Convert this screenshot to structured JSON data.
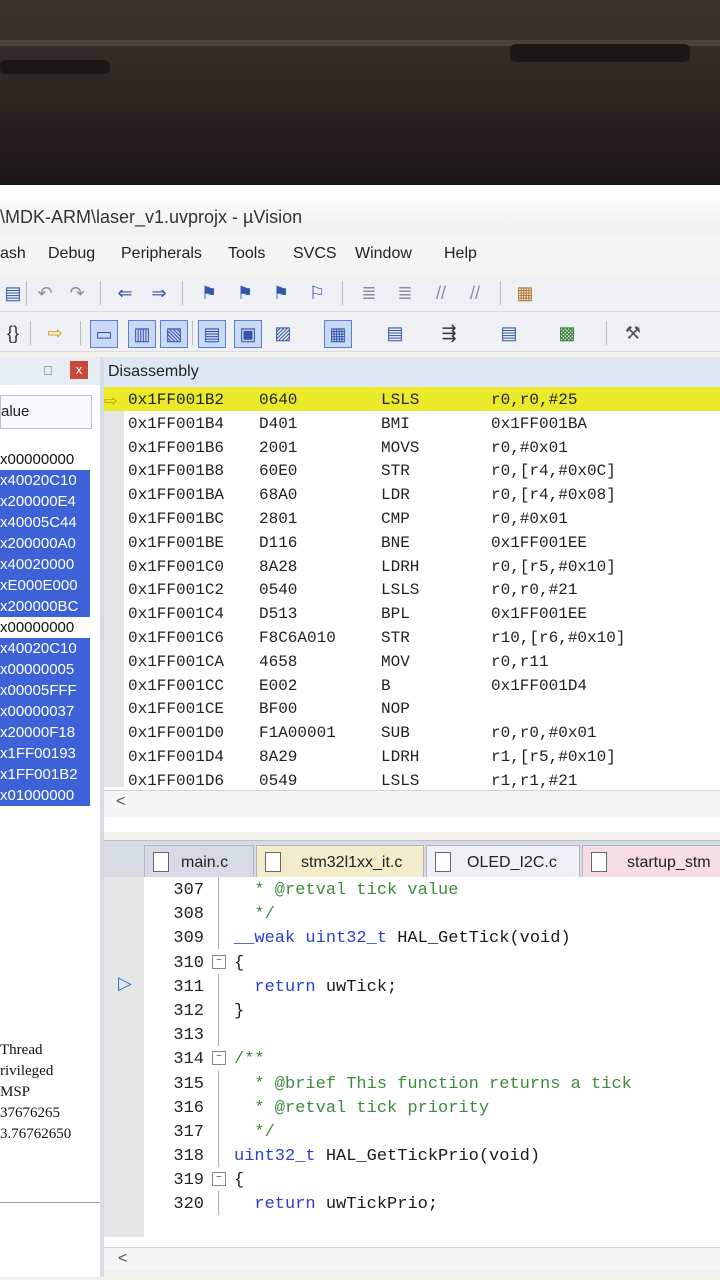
{
  "window": {
    "title": "\\MDK-ARM\\laser_v1.uvprojx - µVision"
  },
  "menu": [
    "ash",
    "Debug",
    "Peripherals",
    "Tools",
    "SVCS",
    "Window",
    "Help"
  ],
  "registers_panel": {
    "pin_label": "⎕",
    "close_label": "x",
    "column_header": "alue",
    "values": [
      {
        "v": "x00000000",
        "hl": false
      },
      {
        "v": "x40020C10",
        "hl": true
      },
      {
        "v": "x200000E4",
        "hl": true
      },
      {
        "v": "x40005C44",
        "hl": true
      },
      {
        "v": "x200000A0",
        "hl": true
      },
      {
        "v": "x40020000",
        "hl": true
      },
      {
        "v": "xE000E000",
        "hl": true
      },
      {
        "v": "x200000BC",
        "hl": true
      },
      {
        "v": "x00000000",
        "hl": false
      },
      {
        "v": "x40020C10",
        "hl": true
      },
      {
        "v": "x00000005",
        "hl": true
      },
      {
        "v": "x00005FFF",
        "hl": true
      },
      {
        "v": "x00000037",
        "hl": true
      },
      {
        "v": "x20000F18",
        "hl": true
      },
      {
        "v": "x1FF00193",
        "hl": true
      },
      {
        "v": "x1FF001B2",
        "hl": true
      },
      {
        "v": "x01000000",
        "hl": true
      }
    ],
    "status": [
      "Thread",
      "rivileged",
      "MSP",
      "37676265",
      "3.76762650"
    ]
  },
  "disassembly": {
    "title": "Disassembly",
    "rows": [
      {
        "addr": "0x1FF001B2",
        "op": "0640",
        "mn": "LSLS",
        "arg": "r0,r0,#25",
        "cur": true
      },
      {
        "addr": "0x1FF001B4",
        "op": "D401",
        "mn": "BMI",
        "arg": "0x1FF001BA",
        "cur": false
      },
      {
        "addr": "0x1FF001B6",
        "op": "2001",
        "mn": "MOVS",
        "arg": "r0,#0x01",
        "cur": false
      },
      {
        "addr": "0x1FF001B8",
        "op": "60E0",
        "mn": "STR",
        "arg": "r0,[r4,#0x0C]",
        "cur": false
      },
      {
        "addr": "0x1FF001BA",
        "op": "68A0",
        "mn": "LDR",
        "arg": "r0,[r4,#0x08]",
        "cur": false
      },
      {
        "addr": "0x1FF001BC",
        "op": "2801",
        "mn": "CMP",
        "arg": "r0,#0x01",
        "cur": false
      },
      {
        "addr": "0x1FF001BE",
        "op": "D116",
        "mn": "BNE",
        "arg": "0x1FF001EE",
        "cur": false
      },
      {
        "addr": "0x1FF001C0",
        "op": "8A28",
        "mn": "LDRH",
        "arg": "r0,[r5,#0x10]",
        "cur": false
      },
      {
        "addr": "0x1FF001C2",
        "op": "0540",
        "mn": "LSLS",
        "arg": "r0,r0,#21",
        "cur": false
      },
      {
        "addr": "0x1FF001C4",
        "op": "D513",
        "mn": "BPL",
        "arg": "0x1FF001EE",
        "cur": false
      },
      {
        "addr": "0x1FF001C6",
        "op": "F8C6A010",
        "mn": "STR",
        "arg": "r10,[r6,#0x10]",
        "cur": false
      },
      {
        "addr": "0x1FF001CA",
        "op": "4658",
        "mn": "MOV",
        "arg": "r0,r11",
        "cur": false
      },
      {
        "addr": "0x1FF001CC",
        "op": "E002",
        "mn": "B",
        "arg": "0x1FF001D4",
        "cur": false
      },
      {
        "addr": "0x1FF001CE",
        "op": "BF00",
        "mn": "NOP",
        "arg": "",
        "cur": false
      },
      {
        "addr": "0x1FF001D0",
        "op": "F1A00001",
        "mn": "SUB",
        "arg": "r0,r0,#0x01",
        "cur": false
      },
      {
        "addr": "0x1FF001D4",
        "op": "8A29",
        "mn": "LDRH",
        "arg": "r1,[r5,#0x10]",
        "cur": false
      },
      {
        "addr": "0x1FF001D6",
        "op": "0549",
        "mn": "LSLS",
        "arg": "r1,r1,#21",
        "cur": false
      }
    ],
    "scroll_left": "<"
  },
  "tabs": [
    {
      "label": "main.c",
      "color": "#d6dbe6"
    },
    {
      "label": "stm32l1xx_it.c",
      "color": "#f3eccb"
    },
    {
      "label": "OLED_I2C.c",
      "color": "#eef0f5"
    },
    {
      "label": "startup_stm",
      "color": "#f5dde3"
    }
  ],
  "editor": {
    "lines": [
      {
        "n": "307",
        "fold": "",
        "parts": [
          [
            "cm",
            "  * @retval tick value"
          ]
        ]
      },
      {
        "n": "308",
        "fold": "",
        "parts": [
          [
            "cm",
            "  */"
          ]
        ]
      },
      {
        "n": "309",
        "fold": "",
        "parts": [
          [
            "kw",
            "__weak uint32_t "
          ],
          [
            "tx",
            "HAL_GetTick(void)"
          ]
        ]
      },
      {
        "n": "310",
        "fold": "−",
        "parts": [
          [
            "tx",
            "{"
          ]
        ]
      },
      {
        "n": "311",
        "fold": "",
        "parts": [
          [
            "kw",
            "  return "
          ],
          [
            "tx",
            "uwTick;"
          ]
        ]
      },
      {
        "n": "312",
        "fold": "",
        "parts": [
          [
            "tx",
            "}"
          ]
        ]
      },
      {
        "n": "313",
        "fold": "",
        "parts": [
          [
            "tx",
            ""
          ]
        ]
      },
      {
        "n": "314",
        "fold": "−",
        "parts": [
          [
            "cm",
            "/**"
          ]
        ]
      },
      {
        "n": "315",
        "fold": "",
        "parts": [
          [
            "cm",
            "  * @brief This function returns a tick"
          ]
        ]
      },
      {
        "n": "316",
        "fold": "",
        "parts": [
          [
            "cm",
            "  * @retval tick priority"
          ]
        ]
      },
      {
        "n": "317",
        "fold": "",
        "parts": [
          [
            "cm",
            "  */"
          ]
        ]
      },
      {
        "n": "318",
        "fold": "",
        "parts": [
          [
            "kw",
            "uint32_t "
          ],
          [
            "tx",
            "HAL_GetTickPrio(void)"
          ]
        ]
      },
      {
        "n": "319",
        "fold": "−",
        "parts": [
          [
            "tx",
            "{"
          ]
        ]
      },
      {
        "n": "320",
        "fold": "",
        "parts": [
          [
            "kw",
            "  return "
          ],
          [
            "tx",
            "uwTickPrio;"
          ]
        ]
      }
    ],
    "scroll_left": "<"
  },
  "colors": {
    "current_line": "#eaea2a",
    "selection": "#3d62d8",
    "comment": "#3f8a3f",
    "keyword": "#2a3fd1"
  },
  "icons": [
    "save-icon",
    "undo-icon",
    "redo-icon",
    "nav-back-icon",
    "nav-forward-icon",
    "bookmark-icon",
    "indent-icon",
    "comment-icon",
    "build-icon",
    "braces-icon",
    "step-arrow-icon",
    "window-icon",
    "watch-icon",
    "memory-icon",
    "serial-icon",
    "analysis-icon",
    "trace-icon",
    "toolbox-icon",
    "settings-icon"
  ]
}
